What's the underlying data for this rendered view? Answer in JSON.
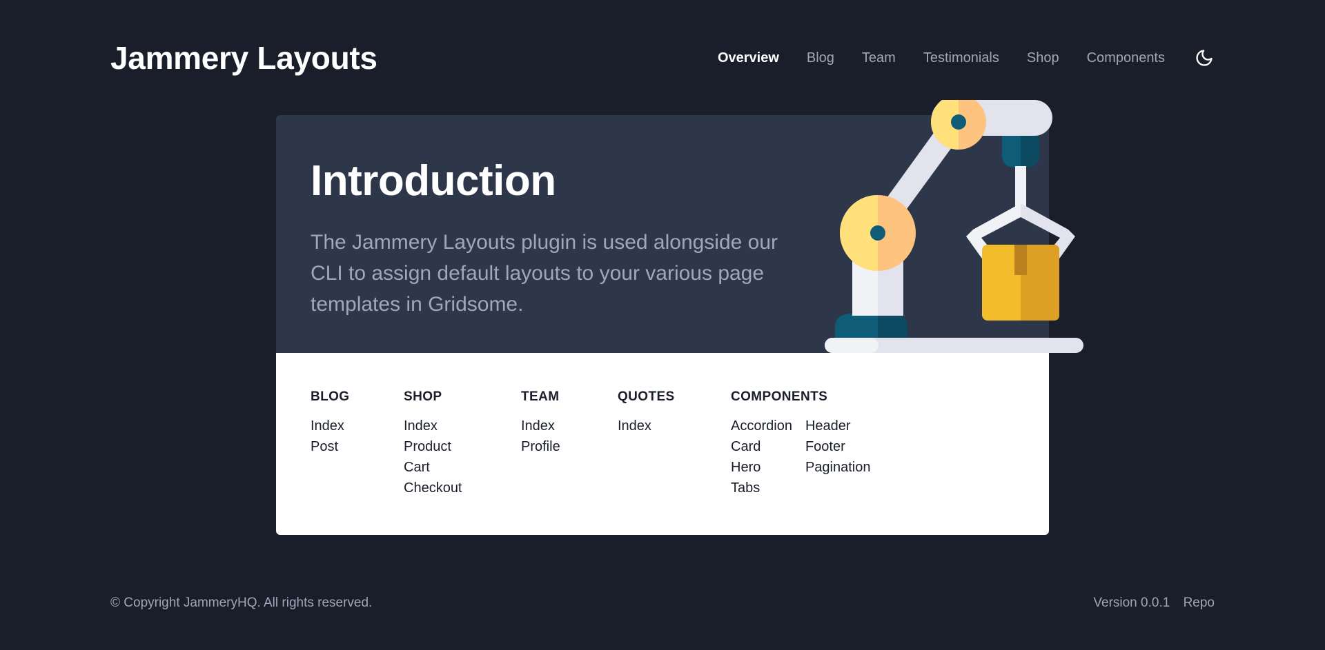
{
  "header": {
    "logo": "Jammery Layouts",
    "nav": [
      "Overview",
      "Blog",
      "Team",
      "Testimonials",
      "Shop",
      "Components"
    ],
    "active_nav": "Overview",
    "theme_toggle_icon": "moon-icon"
  },
  "hero": {
    "title": "Introduction",
    "description": "The Jammery Layouts plugin is used alongside our CLI to assign default layouts to your various page templates in Gridsome.",
    "illustration_icon": "robot-arm-icon"
  },
  "links": {
    "blog": {
      "heading": "BLOG",
      "items": [
        "Index",
        "Post"
      ]
    },
    "shop": {
      "heading": "SHOP",
      "items": [
        "Index",
        "Product",
        "Cart",
        "Checkout"
      ]
    },
    "team": {
      "heading": "TEAM",
      "items": [
        "Index",
        "Profile"
      ]
    },
    "quotes": {
      "heading": "QUOTES",
      "items": [
        "Index"
      ]
    },
    "components": {
      "heading": "COMPONENTS",
      "items_col1": [
        "Accordion",
        "Card",
        "Hero",
        "Tabs"
      ],
      "items_col2": [
        "Header",
        "Footer",
        "Pagination"
      ]
    }
  },
  "footer": {
    "copyright": "© Copyright JammeryHQ. All rights reserved.",
    "version": "Version 0.0.1",
    "repo_link": "Repo"
  },
  "colors": {
    "background": "#1a1e2b",
    "hero_background": "#2e3749",
    "panel_background": "#ffffff",
    "muted_text": "#a0a7b8"
  }
}
